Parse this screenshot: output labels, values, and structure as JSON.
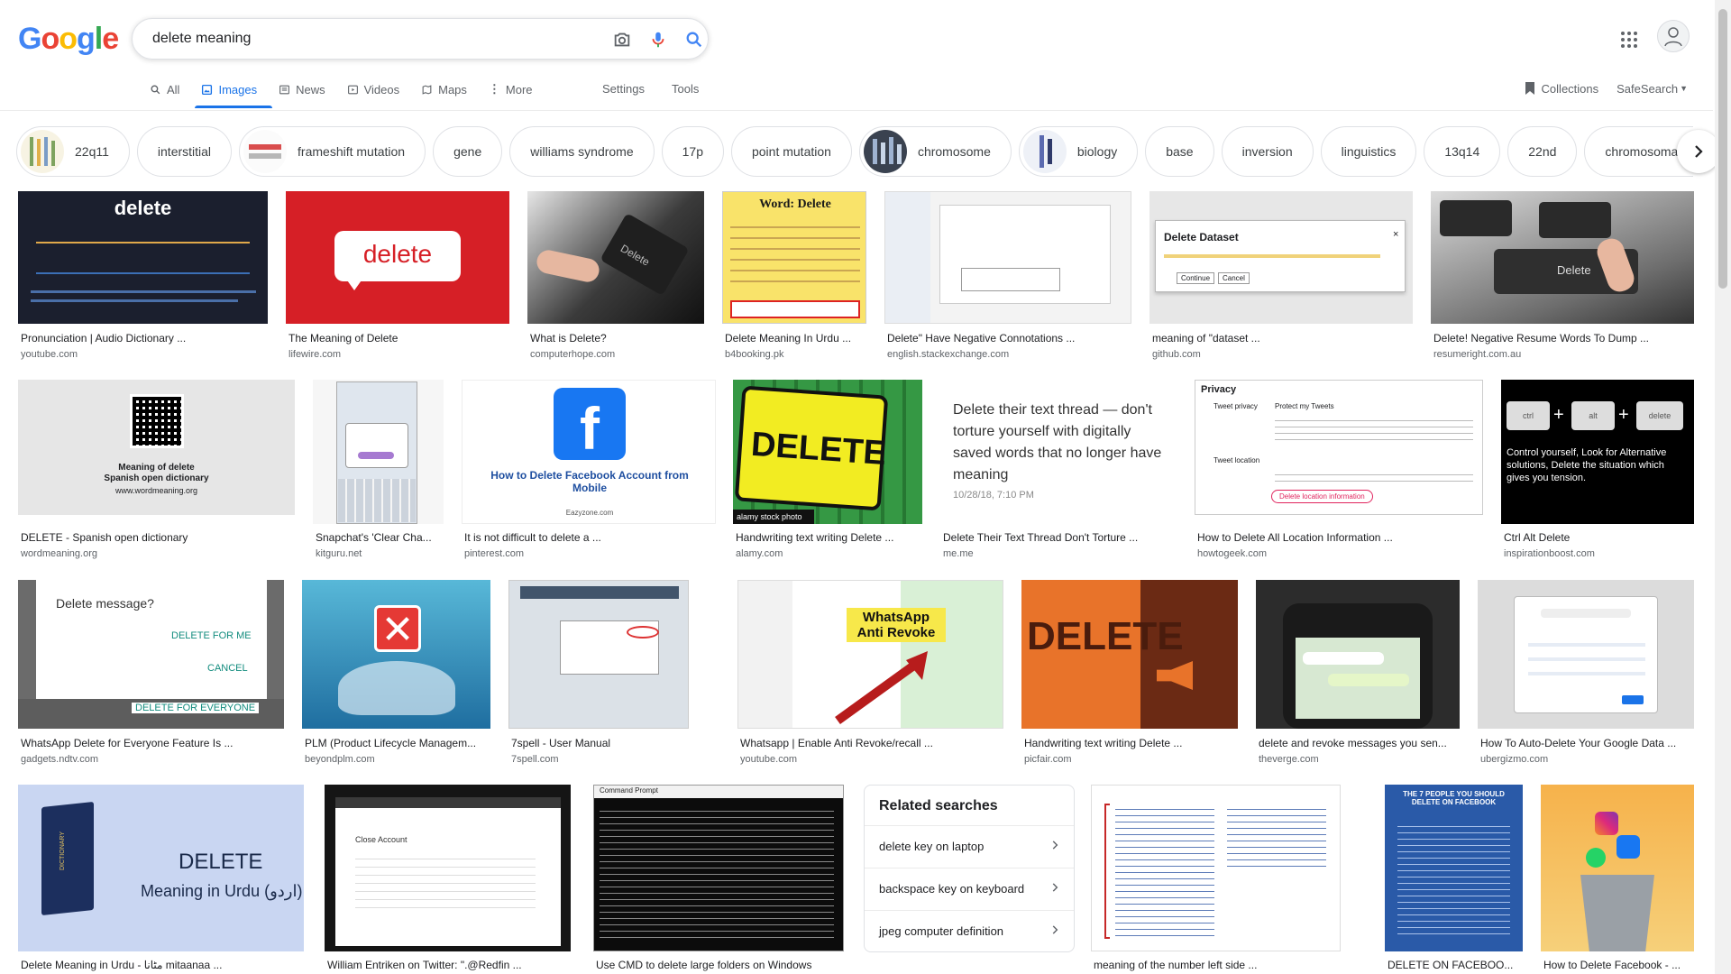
{
  "logo": {
    "letters": [
      "G",
      "o",
      "o",
      "g",
      "l",
      "e"
    ],
    "colors": [
      "#4285f4",
      "#ea4335",
      "#fbbc05",
      "#4285f4",
      "#34a853",
      "#ea4335"
    ]
  },
  "search": {
    "query": "delete meaning",
    "placeholder": ""
  },
  "tabs": [
    {
      "label": "All",
      "icon": "search-icon",
      "active": false
    },
    {
      "label": "Images",
      "icon": "image-icon",
      "active": true
    },
    {
      "label": "News",
      "icon": "news-icon",
      "active": false
    },
    {
      "label": "Videos",
      "icon": "video-icon",
      "active": false
    },
    {
      "label": "Maps",
      "icon": "map-icon",
      "active": false
    },
    {
      "label": "More",
      "icon": "more-vert-icon",
      "active": false
    }
  ],
  "tools": {
    "settings": "Settings",
    "tools": "Tools"
  },
  "right": {
    "collections": "Collections",
    "safesearch": "SafeSearch"
  },
  "chips": [
    "22q11",
    "interstitial",
    "frameshift mutation",
    "gene",
    "williams syndrome",
    "17p",
    "point mutation",
    "chromosome",
    "biology",
    "base",
    "inversion",
    "linguistics",
    "13q14",
    "22nd",
    "chromosomal mutati"
  ],
  "images": [
    {
      "caption": "Pronunciation | Audio Dictionary ...",
      "domain": "youtube.com",
      "text": "delete"
    },
    {
      "caption": "The Meaning of Delete",
      "domain": "lifewire.com",
      "text": "delete"
    },
    {
      "caption": "What is Delete?",
      "domain": "computerhope.com",
      "text": "Delete"
    },
    {
      "caption": "Delete Meaning In Urdu ...",
      "domain": "b4booking.pk",
      "text": "Word: Delete"
    },
    {
      "caption": "Delete\" Have Negative Connotations ...",
      "domain": "english.stackexchange.com",
      "text": ""
    },
    {
      "caption": "meaning of \"dataset ...",
      "domain": "github.com",
      "text": "Delete Dataset"
    },
    {
      "caption": "Delete! Negative Resume Words To Dump ...",
      "domain": "resumeright.com.au",
      "text": "Delete"
    },
    {
      "caption": "DELETE - Spanish open dictionary",
      "domain": "wordmeaning.org",
      "text": "Meaning of delete"
    },
    {
      "caption": "Snapchat's 'Clear Cha...",
      "domain": "kitguru.net",
      "text": ""
    },
    {
      "caption": "It is not difficult to delete a ...",
      "domain": "pinterest.com",
      "text": "How to Delete Facebook Account from Mobile"
    },
    {
      "caption": "Handwriting text writing Delete ...",
      "domain": "alamy.com",
      "text": "DELETE"
    },
    {
      "caption": "Delete Their Text Thread Don't Torture ...",
      "domain": "me.me",
      "text": "Delete their text thread — don't torture yourself with digitally saved words that no longer have meaning"
    },
    {
      "caption": "How to Delete All Location Information ...",
      "domain": "howtogeek.com",
      "text": "Privacy"
    },
    {
      "caption": "Ctrl Alt Delete",
      "domain": "inspirationboost.com",
      "text": "Control yourself, Look for Alternative solutions, Delete the situation which gives you tension."
    },
    {
      "caption": "WhatsApp Delete for Everyone Feature Is ...",
      "domain": "gadgets.ndtv.com",
      "text": "Delete message?"
    },
    {
      "caption": "PLM (Product Lifecycle Managem...",
      "domain": "beyondplm.com",
      "text": ""
    },
    {
      "caption": "7spell - User Manual",
      "domain": "7spell.com",
      "text": ""
    },
    {
      "caption": "Whatsapp | Enable Anti Revoke/recall ...",
      "domain": "youtube.com",
      "text": "WhatsApp Anti Revoke"
    },
    {
      "caption": "Handwriting text writing Delete ...",
      "domain": "picfair.com",
      "text": "DELETE"
    },
    {
      "caption": "delete and revoke messages you sen...",
      "domain": "theverge.com",
      "text": ""
    },
    {
      "caption": "How To Auto-Delete Your Google Data ...",
      "domain": "ubergizmo.com",
      "text": ""
    },
    {
      "caption": "Delete Meaning in Urdu - مٹانا mitaanaa ...",
      "domain": "",
      "text": "DELETE"
    },
    {
      "caption": "William Entriken on Twitter: \".@Redfin ...",
      "domain": "",
      "text": "Close Account"
    },
    {
      "caption": "Use CMD to delete large folders on Windows",
      "domain": "",
      "text": "Command Prompt"
    },
    {
      "caption": "meaning of the number left side ...",
      "domain": "",
      "text": ""
    },
    {
      "caption": "DELETE ON FACEBOO...",
      "domain": "",
      "text": "THE 7 PEOPLE YOU SHOULD DELETE ON FACEBOOK"
    },
    {
      "caption": "How to Delete Facebook - ...",
      "domain": "",
      "text": ""
    }
  ],
  "image_subtexts": {
    "urdu_sub": "Meaning in Urdu (اردو)",
    "delete_for_me": "DELETE FOR ME",
    "cancel": "CANCEL",
    "delete_for_everyone": "DELETE FOR EVERYONE",
    "alamy": "alamy stock photo",
    "me_date": "10/28/18, 7:10 PM",
    "dataset_btn1": "Continue",
    "dataset_btn2": "Cancel",
    "spanish_sub": "Spanish open dictionary",
    "spanish_url": "www.wordmeaning.org",
    "eazyzone": "Eazyzone.com",
    "ctrl": "ctrl",
    "alt": "alt",
    "del": "delete",
    "privacy_tweet": "Tweet privacy",
    "privacy_protect": "Protect my Tweets",
    "privacy_location": "Tweet location",
    "privacy_delete": "Delete location information",
    "dictionary": "DICTIONARY"
  },
  "related": {
    "title": "Related searches",
    "items": [
      "delete key on laptop",
      "backspace key on keyboard",
      "jpeg computer definition"
    ]
  },
  "colors": {
    "accent": "#1a73e8",
    "text": "#202124",
    "muted": "#5f6368"
  }
}
